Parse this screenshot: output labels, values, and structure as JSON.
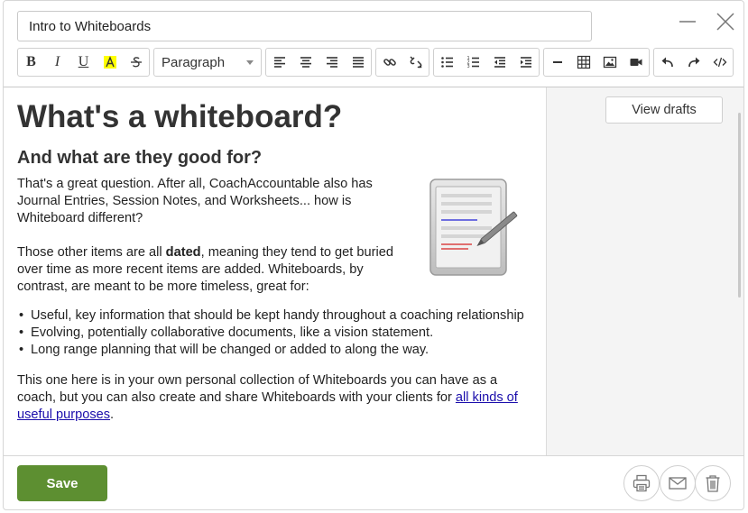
{
  "title_field": {
    "value": "Intro to Whiteboards"
  },
  "window": {
    "minimize_icon": "minimize-icon",
    "close_icon": "close-icon"
  },
  "toolbar": {
    "bold_label": "B",
    "italic_label": "I",
    "underline_label": "U",
    "format_select": "Paragraph",
    "icons": [
      "bold",
      "italic",
      "underline",
      "highlight",
      "strikethrough",
      "align-left",
      "align-center",
      "align-right",
      "justify",
      "link",
      "unlink",
      "bullet-list",
      "numbered-list",
      "outdent",
      "indent",
      "horizontal-rule",
      "table",
      "image",
      "video",
      "undo",
      "redo",
      "code"
    ]
  },
  "content": {
    "heading": "What's a whiteboard?",
    "subheading": "And what are they good for?",
    "p1": "That's a great question.  After all, CoachAccountable also has Journal Entries, Session Notes, and Worksheets... how is Whiteboard different?",
    "p2_before": "Those other items are all ",
    "p2_bold": "dated",
    "p2_after": ", meaning they tend to get buried over time as more recent items are added.  Whiteboards, by contrast, are meant to be more timeless, great for:",
    "list": [
      "Useful, key information that should be kept handy throughout a coaching relationship",
      "Evolving, potentially collaborative documents, like a vision statement.",
      "Long range planning that will be changed or added to along the way."
    ],
    "p3_before": "This one here is in your own personal collection of Whiteboards you can have as a coach, but you can also create and share Whiteboards with your clients for ",
    "p3_link": "all kinds of useful purposes",
    "p3_after": "."
  },
  "side": {
    "view_drafts_label": "View drafts"
  },
  "footer": {
    "save_label": "Save",
    "icons": [
      "print-icon",
      "mail-icon",
      "trash-icon"
    ]
  },
  "colors": {
    "save_button": "#5d8f31",
    "link": "#1a0dab",
    "side_panel": "#f4f4f4",
    "highlight": "#ffff00"
  }
}
